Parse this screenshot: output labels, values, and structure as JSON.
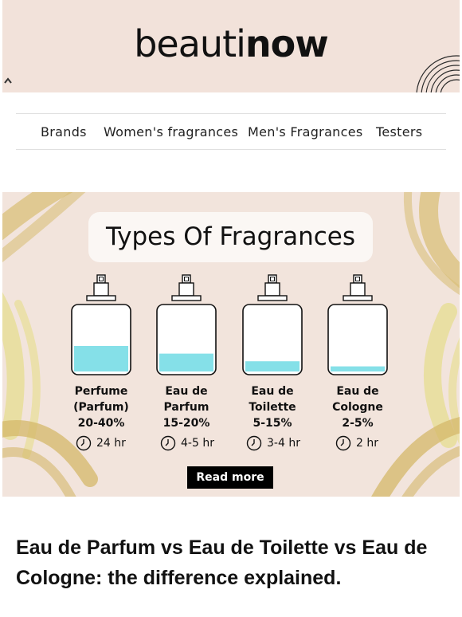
{
  "header": {
    "logo_light": "beauti",
    "logo_bold": "now"
  },
  "nav": {
    "items": [
      {
        "label": "Brands"
      },
      {
        "label": "Women's fragrances"
      },
      {
        "label": "Men's Fragrances"
      },
      {
        "label": "Testers"
      }
    ]
  },
  "infographic": {
    "title": "Types Of Fragrances",
    "types": [
      {
        "lines": [
          "Perfume",
          "(Parfum)",
          "20-40%"
        ],
        "duration": "24 hr",
        "fill": 0.4
      },
      {
        "lines": [
          "Eau de",
          "Parfum",
          "15-20%"
        ],
        "duration": "4-5 hr",
        "fill": 0.28
      },
      {
        "lines": [
          "Eau de",
          "Toilette",
          "5-15%"
        ],
        "duration": "3-4 hr",
        "fill": 0.16
      },
      {
        "lines": [
          "Eau de",
          "Cologne",
          "2-5%"
        ],
        "duration": "2 hr",
        "fill": 0.08
      }
    ],
    "read_more": "Read more",
    "colors": {
      "liquid": "#85e0e8",
      "background": "#f2e4dc",
      "swirl_gold": "#d4b86a",
      "swirl_yellow": "#e6dd8a"
    }
  },
  "article": {
    "headline": "Eau de Parfum vs Eau de Toilette vs Eau de Cologne: the difference explained."
  }
}
